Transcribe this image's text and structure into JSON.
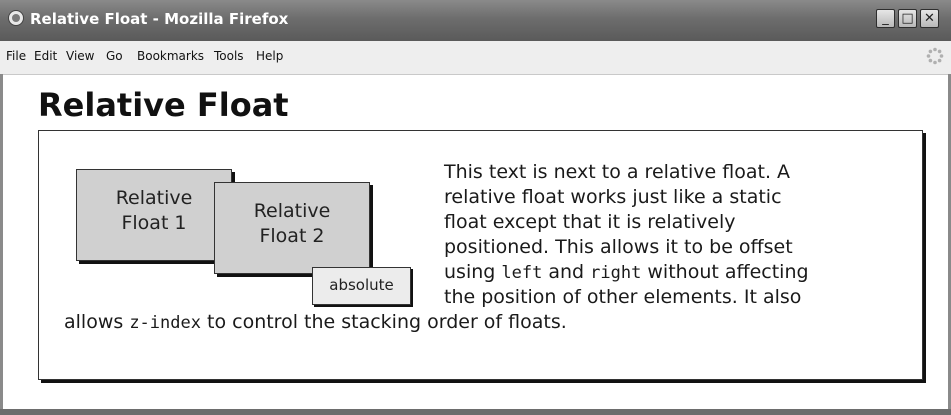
{
  "window": {
    "title": "Relative Float - Mozilla Firefox",
    "controls": {
      "minimize": "_",
      "maximize": "□",
      "close": "✕"
    }
  },
  "menu": {
    "items": [
      "File",
      "Edit",
      "View",
      "Go",
      "Bookmarks",
      "Tools",
      "Help"
    ]
  },
  "page": {
    "heading": "Relative Float",
    "float1": {
      "line1": "Relative",
      "line2": "Float 1"
    },
    "float2": {
      "line1": "Relative",
      "line2": "Float 2"
    },
    "absolute_label": "absolute",
    "paragraph": {
      "l1": "This text is next to a relative float. A",
      "l2": "relative float works just like a static",
      "l3": "float except that it is relatively",
      "l4": "positioned. This allows it to be offset",
      "l5_a": "using ",
      "l5_code1": "left",
      "l5_b": " and ",
      "l5_code2": "right",
      "l5_c": " without affecting",
      "l6": "the position of other elements. It also",
      "l7_a": "allows ",
      "l7_code": "z-index",
      "l7_b": " to control the stacking order of floats."
    }
  }
}
